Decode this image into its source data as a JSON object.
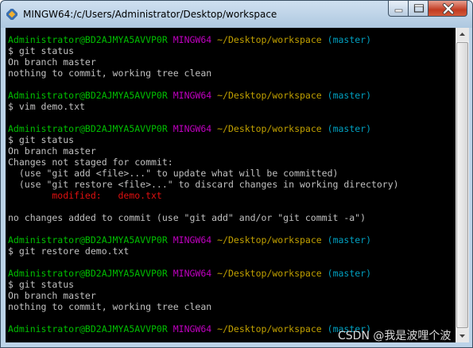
{
  "window": {
    "title": "MINGW64:/c/Users/Administrator/Desktop/workspace"
  },
  "prompt": {
    "user": "Administrator@BD2AJMYA5AVVP0R",
    "env": "MINGW64",
    "path": "~/Desktop/workspace",
    "branch": "(master)"
  },
  "lines": [
    {
      "t": "prompt"
    },
    {
      "t": "text",
      "text": "$ git status"
    },
    {
      "t": "text",
      "text": "On branch master"
    },
    {
      "t": "text",
      "text": "nothing to commit, working tree clean"
    },
    {
      "t": "blank"
    },
    {
      "t": "prompt"
    },
    {
      "t": "text",
      "text": "$ vim demo.txt"
    },
    {
      "t": "blank"
    },
    {
      "t": "prompt"
    },
    {
      "t": "text",
      "text": "$ git status"
    },
    {
      "t": "text",
      "text": "On branch master"
    },
    {
      "t": "text",
      "text": "Changes not staged for commit:"
    },
    {
      "t": "text",
      "text": "  (use \"git add <file>...\" to update what will be committed)"
    },
    {
      "t": "text",
      "text": "  (use \"git restore <file>...\" to discard changes in working directory)"
    },
    {
      "t": "modified",
      "text": "        modified:   demo.txt"
    },
    {
      "t": "blank"
    },
    {
      "t": "text",
      "text": "no changes added to commit (use \"git add\" and/or \"git commit -a\")"
    },
    {
      "t": "blank"
    },
    {
      "t": "prompt"
    },
    {
      "t": "text",
      "text": "$ git restore demo.txt"
    },
    {
      "t": "blank"
    },
    {
      "t": "prompt"
    },
    {
      "t": "text",
      "text": "$ git status"
    },
    {
      "t": "text",
      "text": "On branch master"
    },
    {
      "t": "text",
      "text": "nothing to commit, working tree clean"
    },
    {
      "t": "blank"
    },
    {
      "t": "prompt"
    }
  ],
  "watermark": "CSDN @我是波哩个波",
  "colors": {
    "user": "#00c000",
    "env": "#c000c0",
    "path": "#c0a000",
    "branch": "#00a0c0",
    "modified": "#e01010",
    "text": "#c0c0c0"
  },
  "icons": [
    "app-icon",
    "minimize-icon",
    "maximize-icon",
    "close-icon",
    "scroll-up-arrow-icon",
    "scroll-down-arrow-icon"
  ]
}
